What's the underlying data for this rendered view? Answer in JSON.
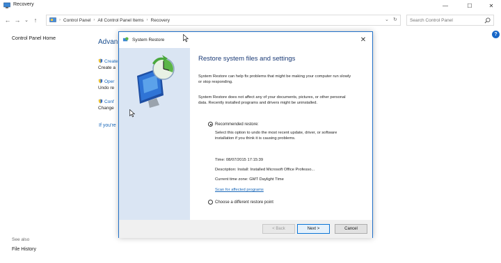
{
  "window": {
    "title": "Recovery",
    "controls": {
      "minimize": "—",
      "maximize": "☐",
      "close": "✕"
    }
  },
  "nav": {
    "back": "←",
    "forward": "→",
    "recent": "⌄",
    "up": "↑"
  },
  "address": {
    "crumbs": [
      "Control Panel",
      "All Control Panel Items",
      "Recovery"
    ],
    "dropdown": "⌄",
    "refresh": "↻"
  },
  "search": {
    "placeholder": "Search Control Panel"
  },
  "help": "?",
  "sidebar": {
    "home": "Control Panel Home",
    "see_also": "See also",
    "file_history": "File History"
  },
  "background": {
    "heading": "Advan",
    "items": [
      {
        "link": "Create",
        "desc": "Create a"
      },
      {
        "link": "Oper",
        "desc": "Undo re"
      },
      {
        "link": "Conf",
        "desc": "Change"
      }
    ],
    "footer_link": "If you're"
  },
  "dialog": {
    "title": "System Restore",
    "close": "✕",
    "heading": "Restore system files and settings",
    "para1": "System Restore can help fix problems that might be making your computer run slowly or stop responding.",
    "para2": "System Restore does not affect any of your documents, pictures, or other personal data. Recently installed programs and drivers might be uninstalled.",
    "option_recommended": "Recommended restore:",
    "recommended_desc": "Select this option to undo the most recent update, driver, or software installation if you think it is causing problems.",
    "time": "Time: 08/07/2015 17:15:39",
    "description": "Description: Install: Installed Microsoft Office Professo...",
    "timezone": "Current time zone: GMT Daylight Time",
    "scan_link": "Scan for affected programs",
    "option_different": "Choose a different restore point",
    "buttons": {
      "back": "< Back",
      "next": "Next >",
      "cancel": "Cancel"
    }
  },
  "colors": {
    "accent": "#1f6fc8",
    "link": "#1766b8",
    "side_panel": "#dae5f3",
    "heading": "#1a3a76"
  }
}
